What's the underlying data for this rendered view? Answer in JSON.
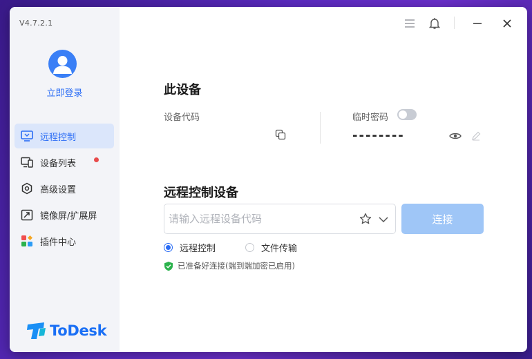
{
  "app": {
    "version": "V4.7.2.1",
    "brand_name": "ToDesk"
  },
  "user": {
    "login_label": "立即登录"
  },
  "sidebar": {
    "items": [
      {
        "label": "远程控制",
        "icon": "monitor-remote-icon",
        "active": true
      },
      {
        "label": "设备列表",
        "icon": "devices-icon",
        "badge": true
      },
      {
        "label": "高级设置",
        "icon": "hexagon-settings-icon"
      },
      {
        "label": "镜像屏/扩展屏",
        "icon": "mirror-screen-icon"
      },
      {
        "label": "插件中心",
        "icon": "plugin-grid-icon"
      }
    ]
  },
  "this_device": {
    "title": "此设备",
    "device_code_label": "设备代码",
    "device_code_value": "",
    "temp_password_label": "临时密码",
    "temp_password_value": "--------"
  },
  "remote": {
    "title": "远程控制设备",
    "input_placeholder": "请输入远程设备代码",
    "input_value": "",
    "connect_label": "连接",
    "modes": [
      {
        "label": "远程控制",
        "selected": true
      },
      {
        "label": "文件传输",
        "selected": false
      }
    ],
    "status_text": "已准备好连接(端到端加密已启用)"
  },
  "colors": {
    "accent": "#2b6df5",
    "connect_disabled": "#9fc6f7",
    "badge": "#e84b4b",
    "status_ok": "#2bb24c"
  }
}
